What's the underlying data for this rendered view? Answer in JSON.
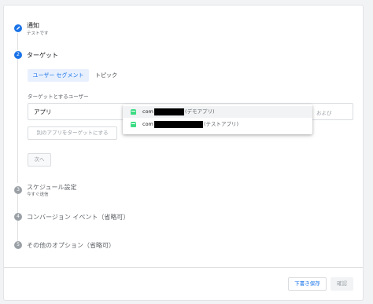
{
  "steps": [
    {
      "number": "",
      "title": "通知",
      "subtitle": "テストです",
      "state": "done"
    },
    {
      "number": "2",
      "title": "ターゲット",
      "subtitle": "",
      "state": "active"
    },
    {
      "number": "3",
      "title": "スケジュール設定",
      "subtitle": "今すぐ送信",
      "state": "pending"
    },
    {
      "number": "4",
      "title": "コンバージョン イベント（省略可）",
      "subtitle": "",
      "state": "pending"
    },
    {
      "number": "5",
      "title": "その他のオプション（省略可）",
      "subtitle": "",
      "state": "pending"
    }
  ],
  "target": {
    "tabs": {
      "segment": "ユーザー セグメント",
      "topic": "トピック"
    },
    "field_label": "ターゲットとするユーザー",
    "app_value": "アプリ",
    "and_text": "および",
    "add_app_button": "別のアプリをターゲットにする",
    "next_button": "次へ"
  },
  "dropdown": {
    "items": [
      {
        "prefix": "com",
        "suffix": "(デモアプリ)"
      },
      {
        "prefix": "com",
        "suffix": "(テストアプリ)"
      }
    ]
  },
  "footer": {
    "save_draft": "下書き保存",
    "confirm": "確認"
  },
  "colors": {
    "accent": "#1a73e8",
    "android": "#3ddc84"
  }
}
